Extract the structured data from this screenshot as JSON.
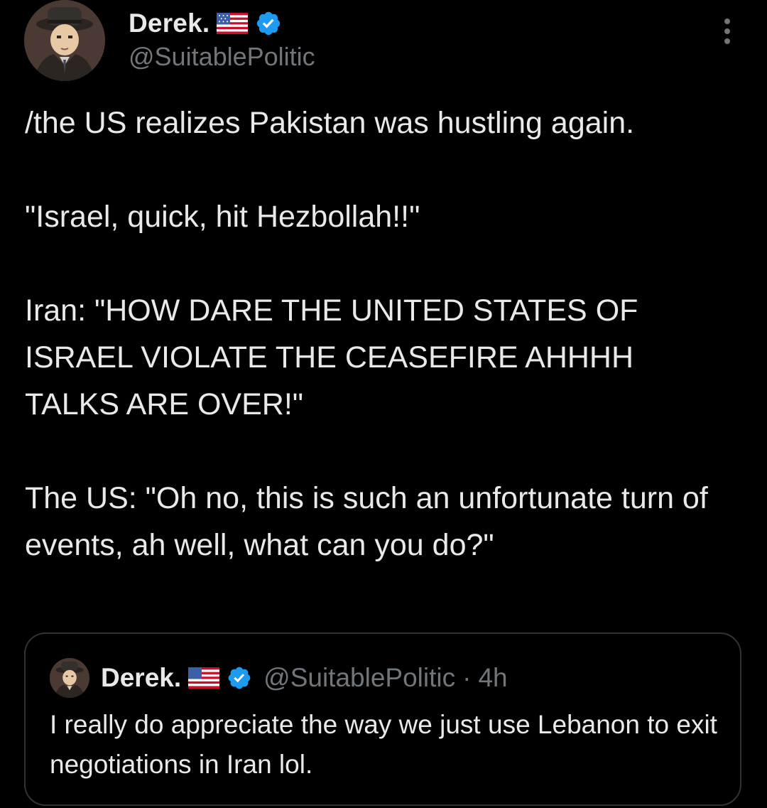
{
  "tweet": {
    "author": {
      "display_name": "Derek.",
      "handle": "@SuitablePolitic",
      "flag_icon": "us-flag-icon",
      "verified_icon": "verified-badge-icon"
    },
    "paragraphs": [
      "/the US realizes Pakistan was hustling again.",
      "\"Israel, quick, hit Hezbollah!!\"",
      "Iran: \"HOW DARE THE UNITED STATES OF ISRAEL VIOLATE THE CEASEFIRE AHHHH TALKS ARE OVER!\"",
      "The US: \"Oh no, this is such an unfortunate turn of events, ah well, what can you do?\""
    ],
    "more_icon": "more-options-icon"
  },
  "quote": {
    "author": {
      "display_name": "Derek.",
      "handle": "@SuitablePolitic",
      "separator": "·",
      "time": "4h"
    },
    "text": "I really do appreciate the way we just use Lebanon to exit negotiations in Iran lol."
  },
  "colors": {
    "background": "#000000",
    "text_primary": "#e7e9ea",
    "text_secondary": "#71767b",
    "border": "#2f3336",
    "verified_blue": "#1d9bf0"
  }
}
